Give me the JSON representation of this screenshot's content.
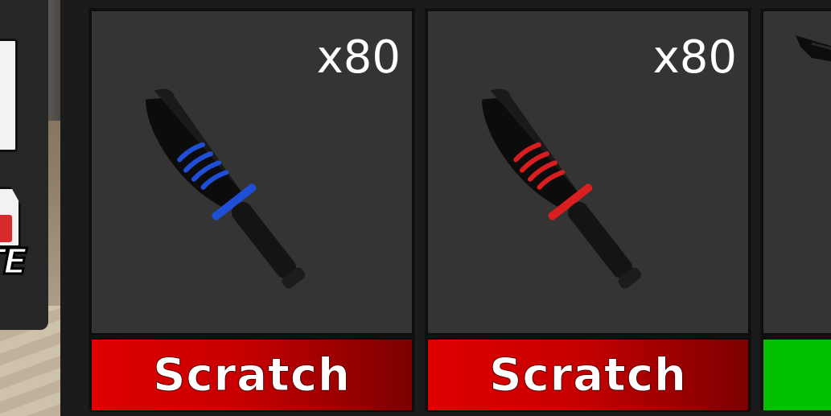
{
  "inventory": {
    "slots": [
      {
        "count": "x80",
        "item_icon": "knife-blue-icon",
        "accent_color": "#1f4fd6",
        "action_label": "Scratch"
      },
      {
        "count": "x80",
        "item_icon": "knife-red-icon",
        "accent_color": "#d81e1e",
        "action_label": "Scratch"
      }
    ],
    "partial_slot": {
      "item_icon": "gun-icon",
      "button_color": "#00c000"
    }
  },
  "colors": {
    "scratch_button": "#e00000",
    "slot_background": "#343434",
    "panel_background": "#1b1b1b"
  }
}
